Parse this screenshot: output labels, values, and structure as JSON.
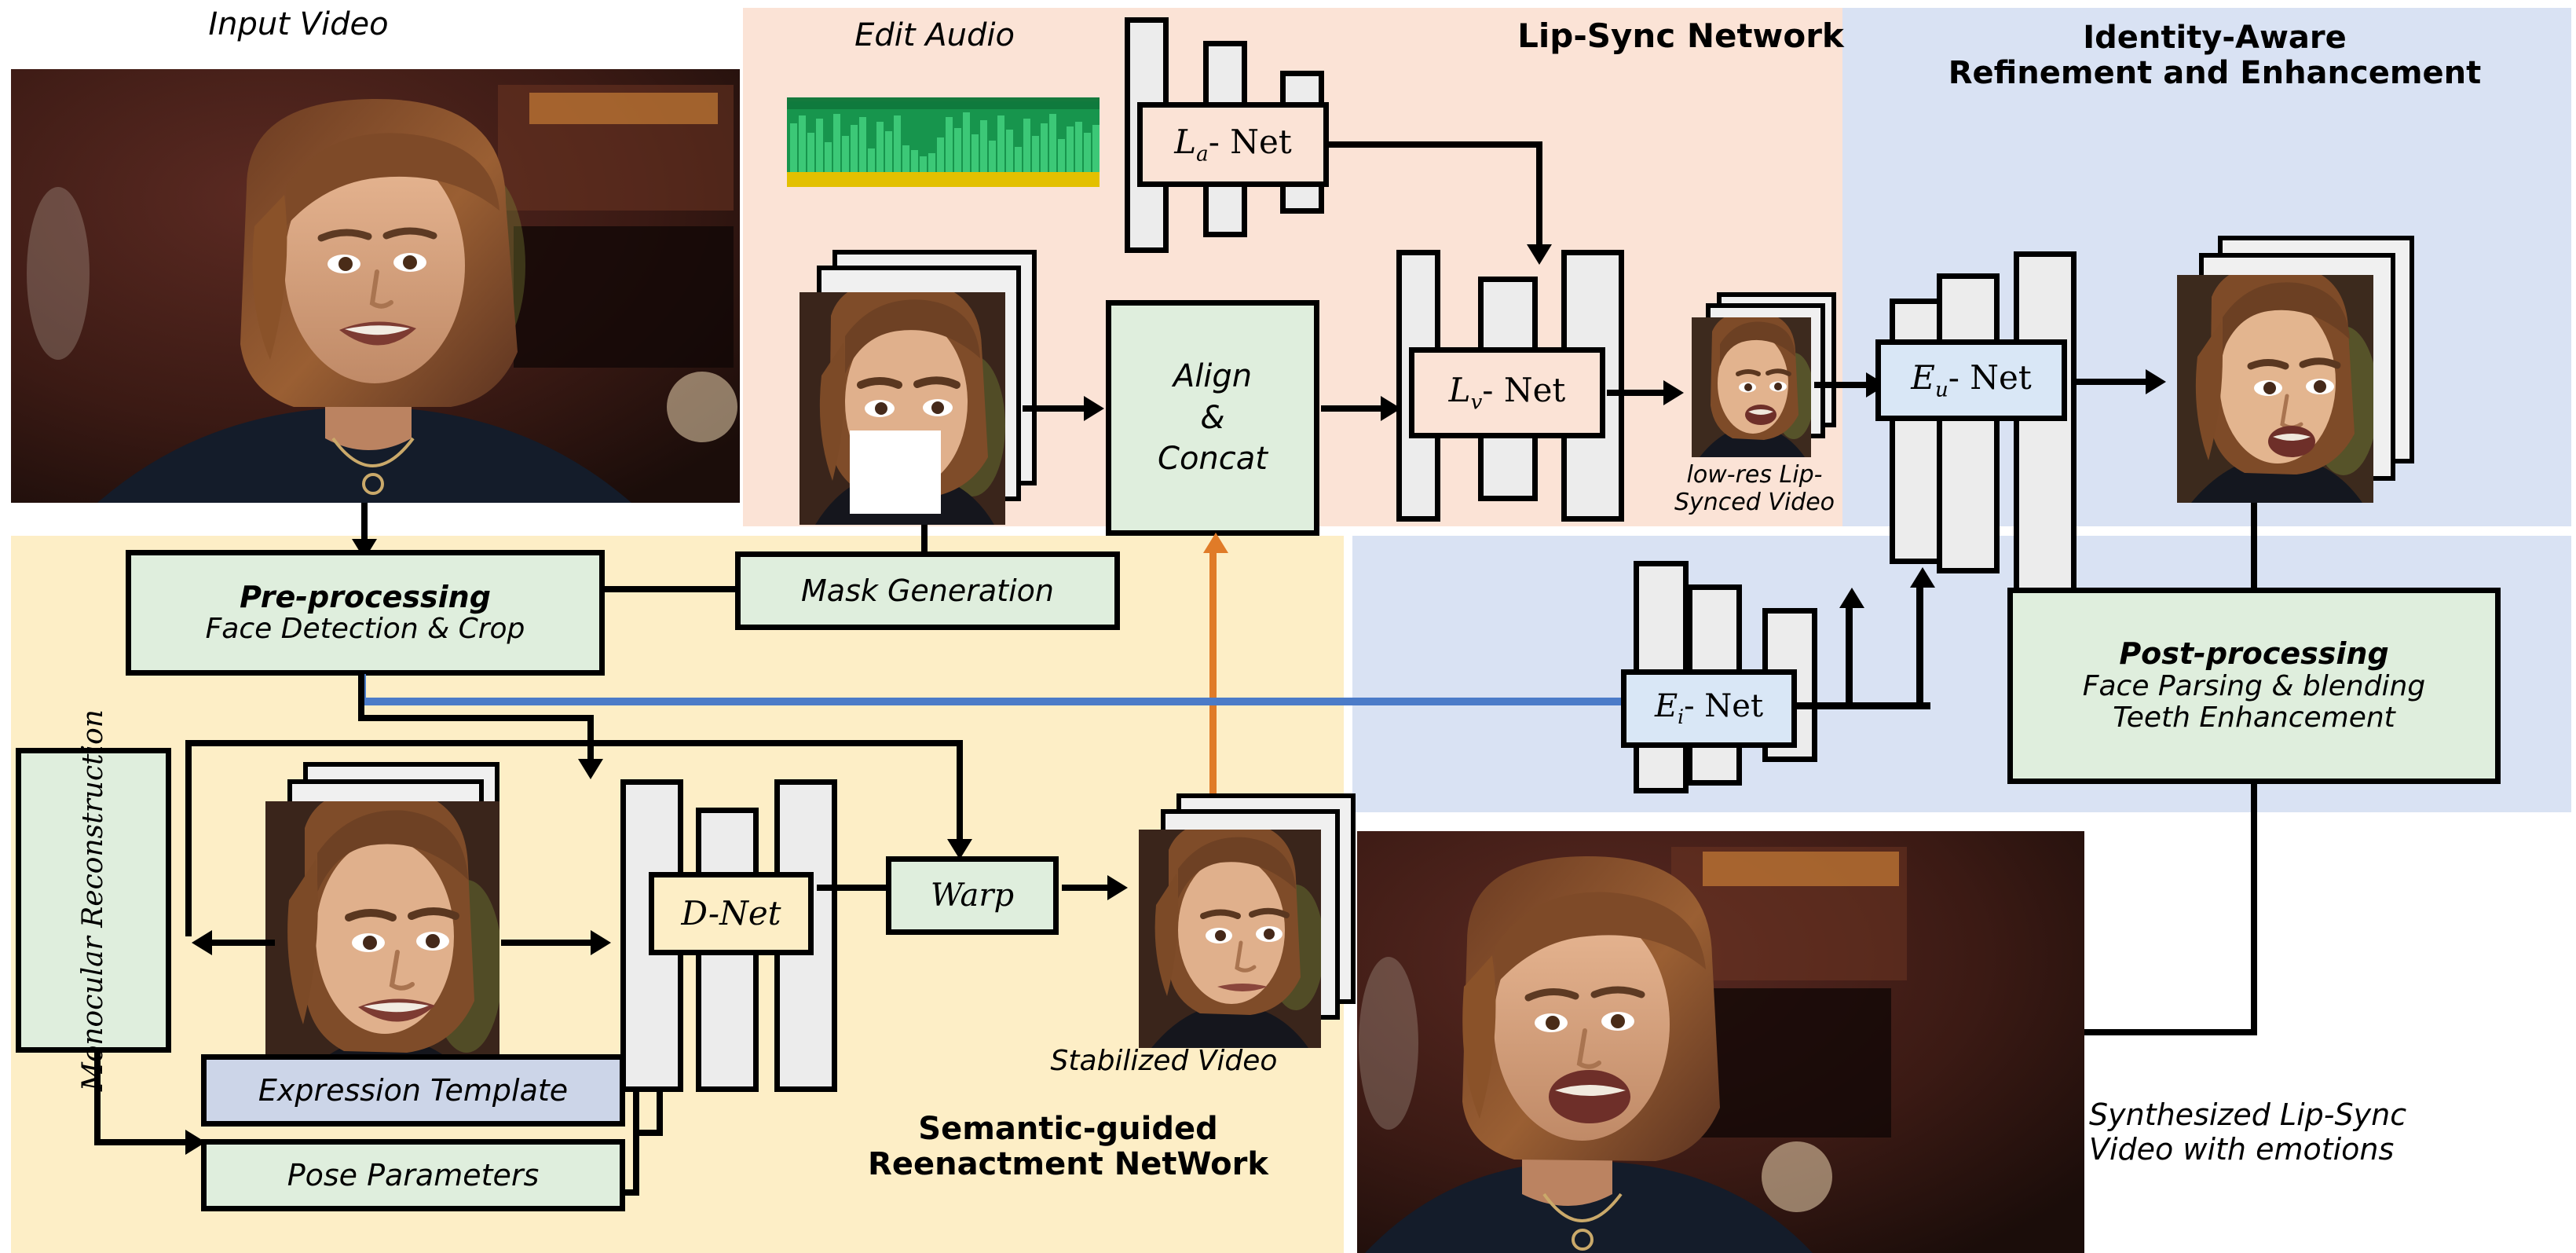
{
  "regions": {
    "lip_sync": {
      "title": "Lip-Sync Network",
      "color": "#fbe3d6"
    },
    "identity": {
      "title_line1": "Identity-Aware",
      "title_line2": "Refinement and Enhancement",
      "color": "#d9e2f3"
    },
    "semantic": {
      "title_line1": "Semantic-guided",
      "title_line2": "Reenactment NetWork",
      "color": "#fdeec6"
    }
  },
  "captions": {
    "input_video": "Input Video",
    "edit_audio": "Edit Audio",
    "low_res_line1": "low-res Lip-",
    "low_res_line2": "Synced Video",
    "stabilized_video": "Stabilized Video",
    "synth_line1": "Synthesized Lip-Sync",
    "synth_line2": "Video with emotions"
  },
  "boxes": {
    "preprocessing": {
      "line1": "Pre-processing",
      "line2": "Face Detection & Crop"
    },
    "mask_generation": {
      "label": "Mask Generation"
    },
    "align_concat": {
      "line1": "Align",
      "line2": "&",
      "line3": "Concat"
    },
    "la_net": {
      "base": "L",
      "sub": "a",
      "tail": "- Net"
    },
    "lv_net": {
      "base": "L",
      "sub": "v",
      "tail": "- Net"
    },
    "eu_net": {
      "base": "E",
      "sub": "u",
      "tail": "- Net"
    },
    "ei_net": {
      "base": "E",
      "sub": "i",
      "tail": "- Net"
    },
    "d_net": {
      "label": "D-Net"
    },
    "warp": {
      "label": "Warp"
    },
    "monocular": {
      "line1": "Monocular",
      "line2": "Reconstruction"
    },
    "expression_template": {
      "label": "Expression Template"
    },
    "pose_parameters": {
      "label": "Pose Parameters"
    },
    "postprocessing": {
      "line1": "Post-processing",
      "line2": "Face Parsing & blending",
      "line3": "Teeth Enhancement"
    }
  },
  "colors": {
    "panel_pink": "#fbe3d6",
    "panel_yellow": "#fdeec6",
    "panel_blue": "#d9e2f3",
    "box_green": "#dfeedd",
    "box_blue": "#d9e7f6",
    "box_lavender": "#ccd5e8",
    "identity_flow_blue": "#4b7bc8",
    "mask_flow_orange": "#e07b28",
    "waveform_green": "#1f9d52",
    "waveform_accent": "#e3c000"
  }
}
